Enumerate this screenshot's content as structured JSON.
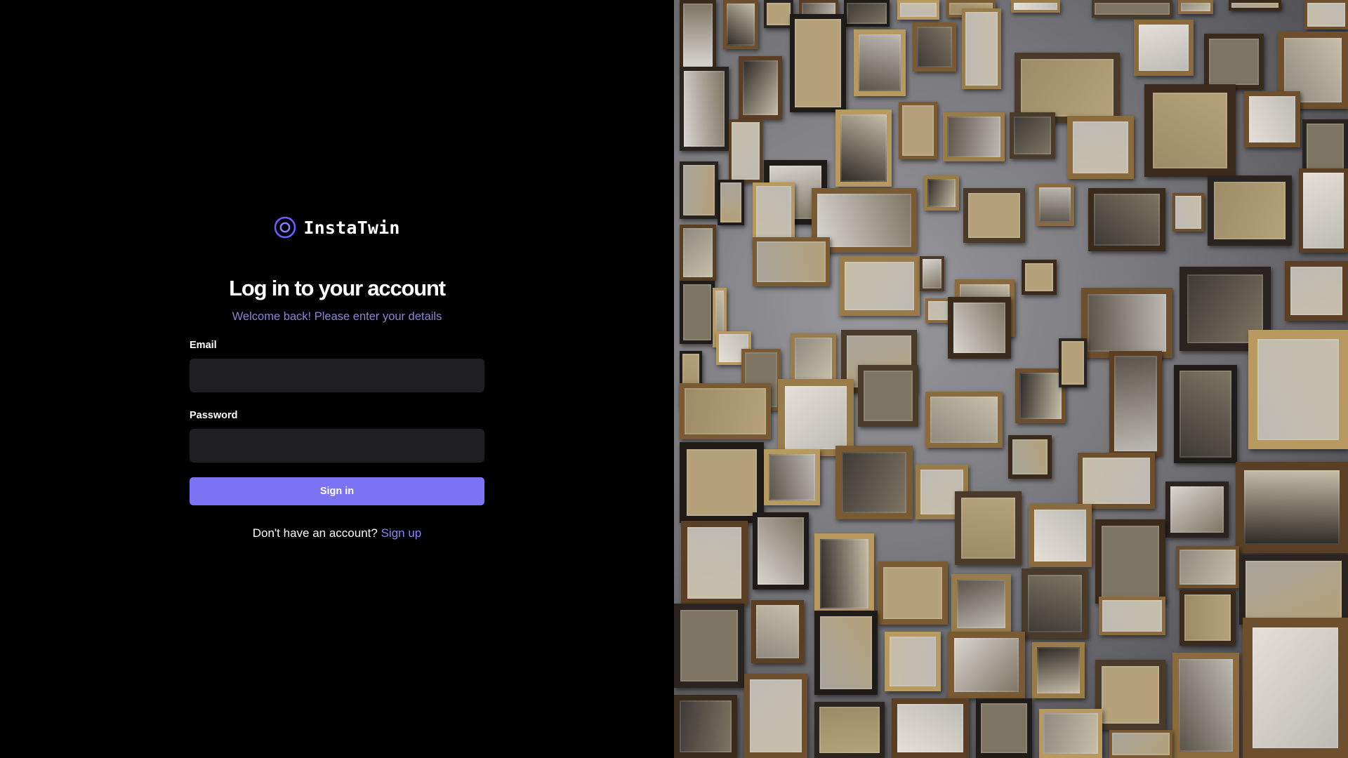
{
  "brand": {
    "name": "InstaTwin",
    "logo_icon": "ring-logo-icon",
    "accent": "#7c72f4"
  },
  "login": {
    "title": "Log in to your account",
    "subtitle": "Welcome back! Please enter your details",
    "email_label": "Email",
    "email_value": "",
    "email_placeholder": "",
    "password_label": "Password",
    "password_value": "",
    "password_placeholder": "",
    "submit_label": "Sign in",
    "signup_prompt": "Don't have an account?",
    "signup_link": "Sign up"
  },
  "hero_image": {
    "subject": "photo-gallery-wall"
  },
  "colors": {
    "background": "#000000",
    "input_background": "#1f1f22",
    "subtitle_text": "#8a83d8",
    "button": "#7c72f4",
    "link": "#8c82ff"
  }
}
